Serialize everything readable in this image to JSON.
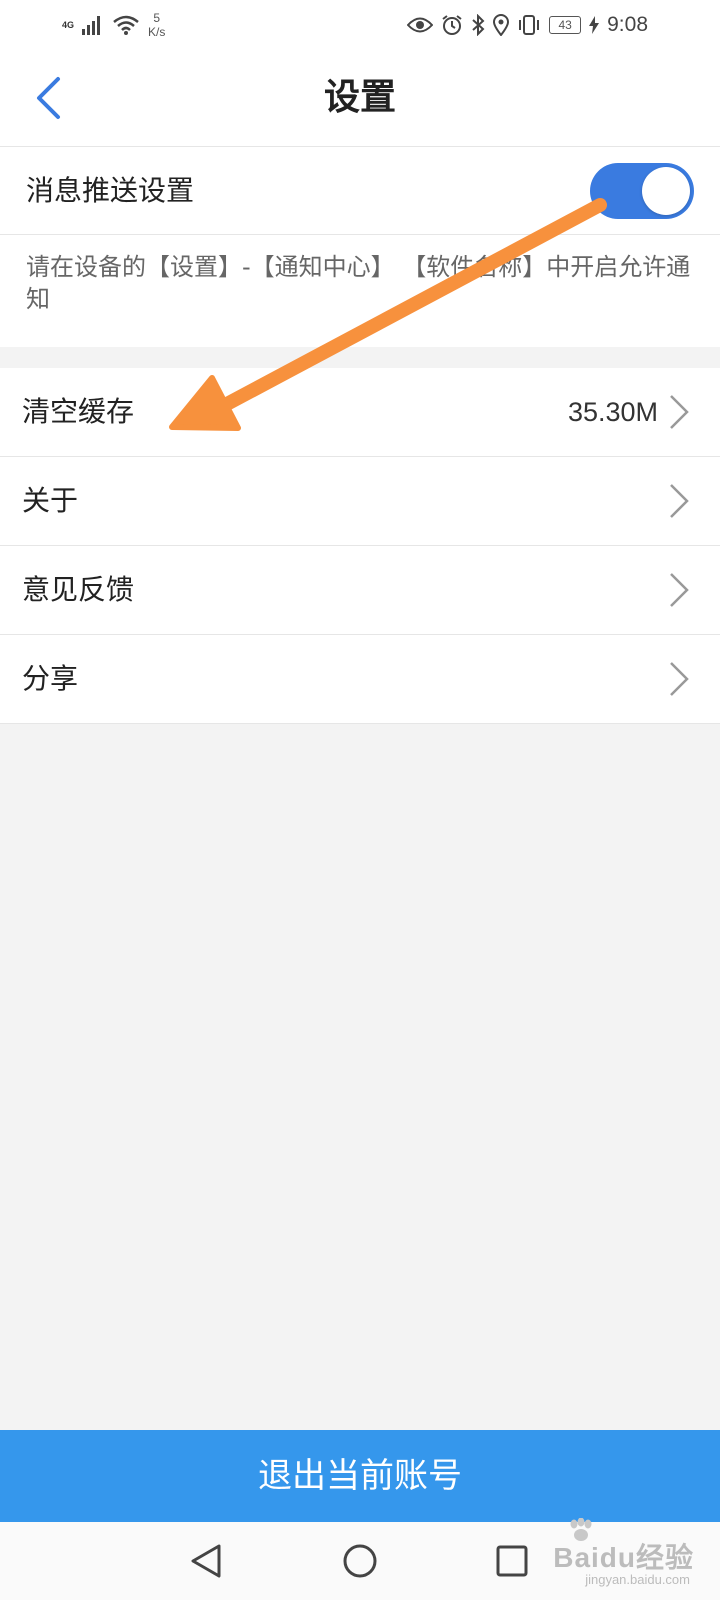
{
  "status_bar": {
    "network_type": "4G",
    "net_speed_value": "5",
    "net_speed_unit": "K/s",
    "battery": "43",
    "time": "9:08",
    "icons": [
      "signal-icon",
      "wifi-icon",
      "eye-icon",
      "alarm-icon",
      "bluetooth-icon",
      "location-icon",
      "vibrate-icon",
      "battery-icon",
      "charging-icon"
    ]
  },
  "header": {
    "title": "设置",
    "back_icon": "chevron-left-icon"
  },
  "push_settings": {
    "label": "消息推送设置",
    "enabled": true,
    "hint": "请在设备的【设置】-【通知中心】 【软件名称】中开启允许通知"
  },
  "menu": {
    "items": [
      {
        "label": "清空缓存",
        "value": "35.30M"
      },
      {
        "label": "关于",
        "value": ""
      },
      {
        "label": "意见反馈",
        "value": ""
      },
      {
        "label": "分享",
        "value": ""
      }
    ]
  },
  "logout": {
    "label": "退出当前账号"
  },
  "watermark": {
    "main": "Baidu经验",
    "sub": "jingyan.baidu.com"
  },
  "colors": {
    "accent": "#3a7be0",
    "logout_bg": "#3597ec",
    "arrow": "#f7913d",
    "page_bg": "#f3f3f3"
  }
}
